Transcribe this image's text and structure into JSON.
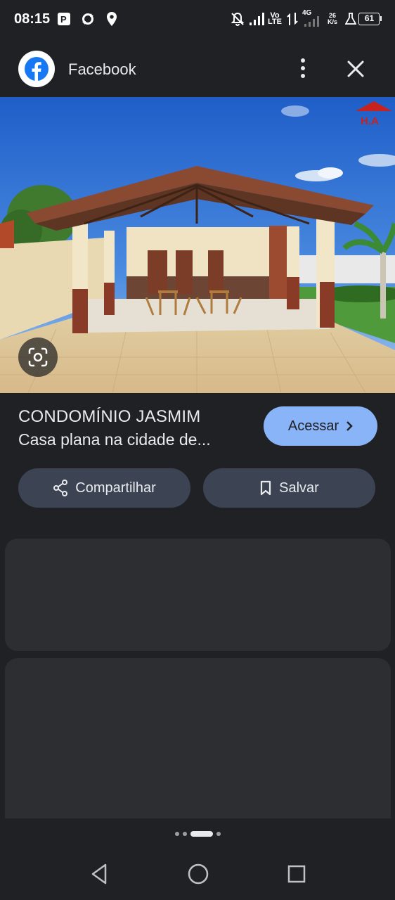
{
  "status_bar": {
    "time": "08:15",
    "volte": [
      "Vo",
      "LTE"
    ],
    "network": "4G",
    "speed": [
      "26",
      "K/s"
    ],
    "battery": "61"
  },
  "header": {
    "app_title": "Facebook",
    "icons": {
      "logo": "facebook-logo",
      "more": "more-vert-icon",
      "close": "close-icon"
    }
  },
  "image": {
    "watermark": "H.A"
  },
  "result": {
    "title": "CONDOMÍNIO JASMIM",
    "description": "Casa plana na cidade de...",
    "visit_label": "Acessar"
  },
  "actions": {
    "share_label": "Compartilhar",
    "save_label": "Salvar"
  },
  "colors": {
    "background": "#202124",
    "accent": "#8ab4f8",
    "pill": "#3c4453",
    "card": "#2d2e31"
  }
}
